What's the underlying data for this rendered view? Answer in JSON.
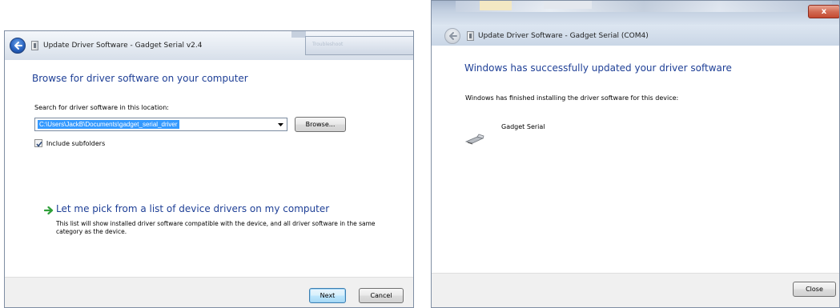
{
  "left_dialog": {
    "window_title": "Update Driver Software - Gadget Serial v2.4",
    "background_tab_label": "Troubleshoot",
    "heading": "Browse for driver software on your computer",
    "search_label": "Search for driver software in this location:",
    "path_value": "C:\\Users\\JackB\\Documents\\gadget_serial_driver",
    "browse_label": "Browse...",
    "include_subfolders": {
      "label": "Include subfolders",
      "checked": true
    },
    "pick_link": {
      "title": "Let me pick from a list of device drivers on my computer",
      "description": "This list will show installed driver software compatible with the device, and all driver software in the same category as the device."
    },
    "next_label": "Next",
    "cancel_label": "Cancel"
  },
  "right_dialog": {
    "window_title": "Update Driver Software - Gadget Serial (COM4)",
    "close_glyph": "x",
    "heading": "Windows has successfully updated your driver software",
    "finished_text": "Windows has finished installing the driver software for this device:",
    "device_name": "Gadget Serial",
    "close_label": "Close"
  },
  "icons": [
    "back-arrow-icon",
    "driver-app-icon",
    "dropdown-arrow-icon",
    "checkmark-icon",
    "green-arrow-icon",
    "serial-device-icon"
  ],
  "colors": {
    "heading_blue": "#1e3f96",
    "selection_blue": "#3399ff",
    "link_arrow_green": "#2fa03a",
    "close_red": "#c44a31",
    "footer_gray": "#f0f0f0"
  }
}
